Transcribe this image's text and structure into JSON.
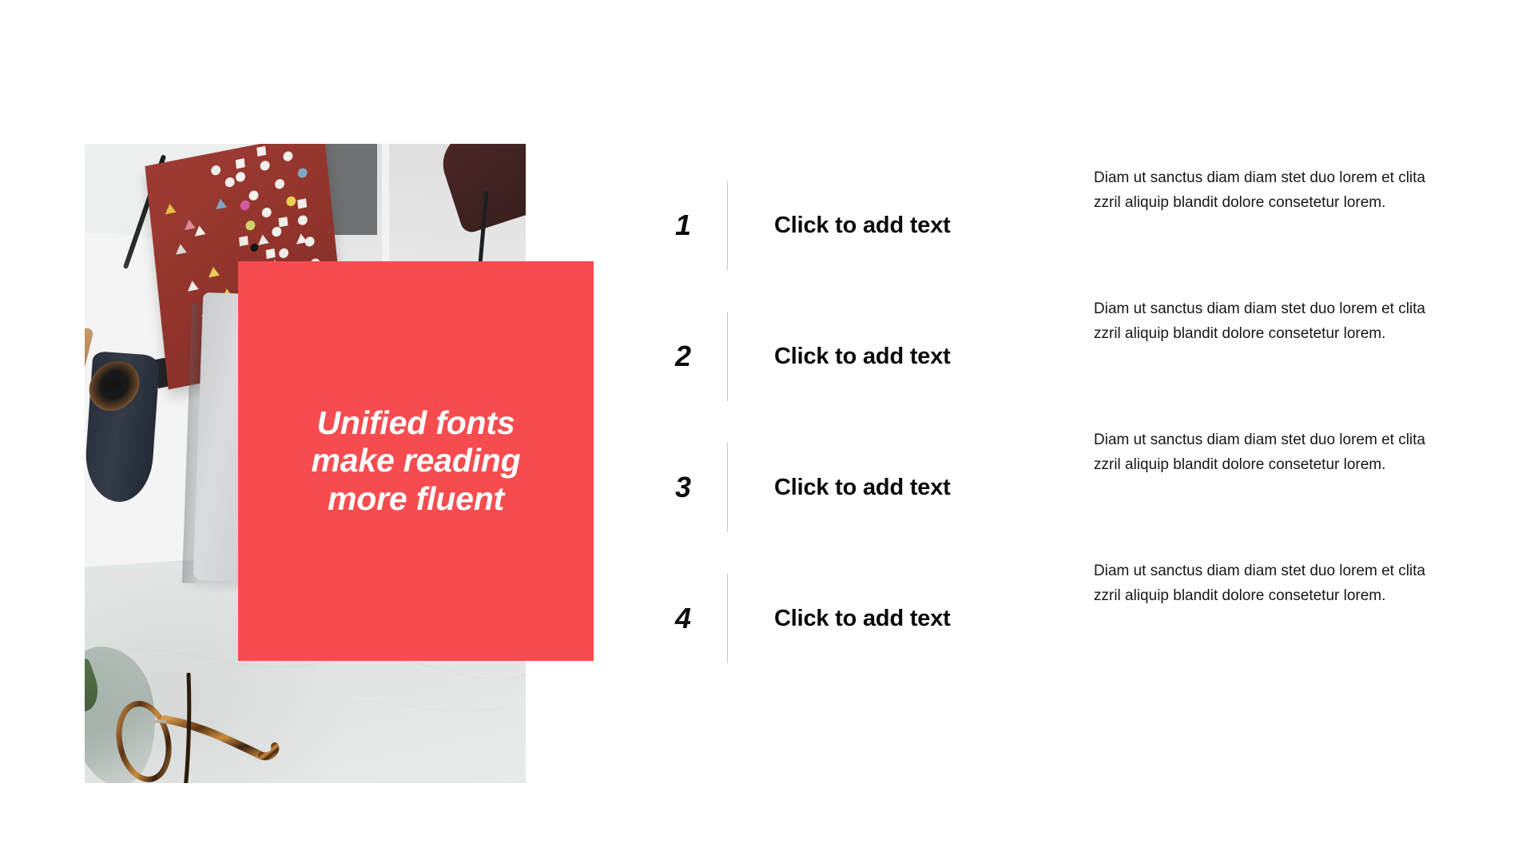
{
  "slide": {
    "background_color": "#ffffff",
    "accent_color": "#F74C4F",
    "divider_color": "#c6c9d7",
    "text_color": "#0a0a0a"
  },
  "visual": {
    "photo_alt": "Top-down photo of a marble desk with a red dotted notebook, pencil, silver laptop, dark coffee mug and tortoiseshell glasses",
    "callout": {
      "text": "Unified fonts\nmake reading\nmore fluent",
      "background_color": "#F74C4F",
      "text_color": "#ffffff"
    }
  },
  "content_list": {
    "items": [
      {
        "number": "1",
        "title": "Click to add text",
        "body": "Diam ut sanctus diam diam stet duo lorem et clita zzril aliquip blandit dolore consetetur lorem."
      },
      {
        "number": "2",
        "title": "Click to add text",
        "body": "Diam ut sanctus diam diam stet duo lorem et clita zzril aliquip blandit dolore consetetur lorem."
      },
      {
        "number": "3",
        "title": "Click to add text",
        "body": "Diam ut sanctus diam diam stet duo lorem et clita zzril aliquip blandit dolore consetetur lorem."
      },
      {
        "number": "4",
        "title": "Click to add text",
        "body": "Diam ut sanctus diam diam stet duo lorem et clita zzril aliquip blandit dolore consetetur lorem."
      }
    ]
  }
}
